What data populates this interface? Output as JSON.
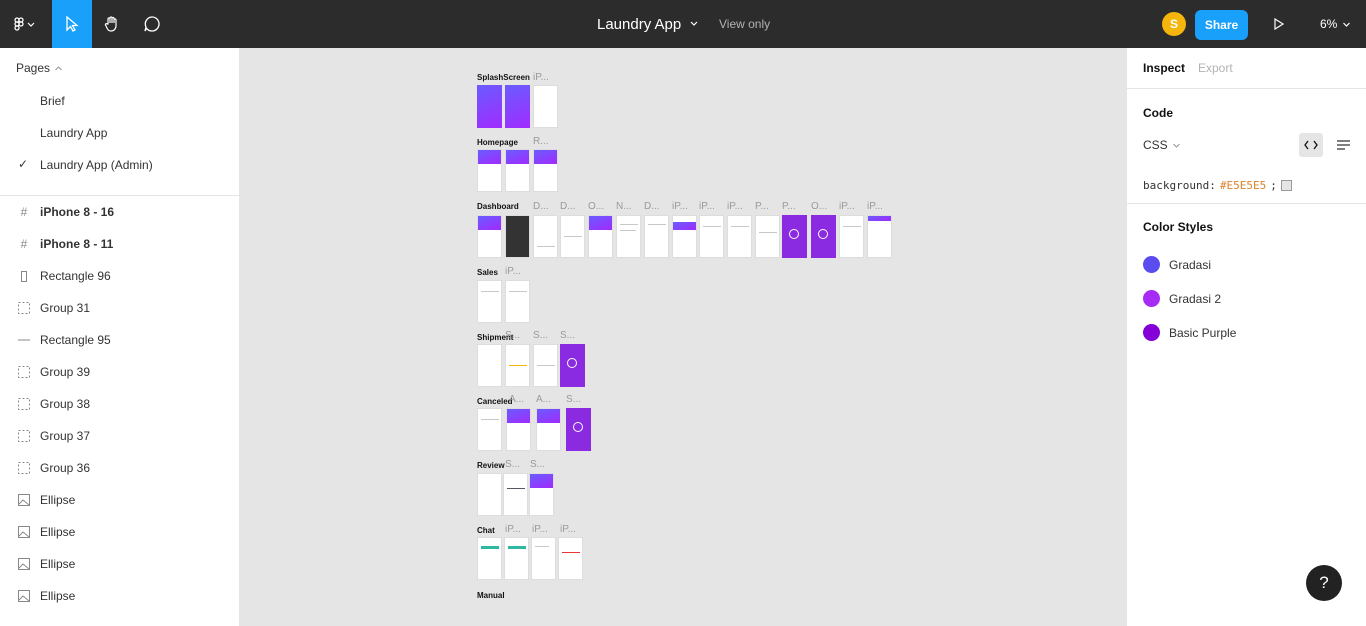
{
  "header": {
    "file_title": "Laundry App",
    "view_mode": "View only",
    "avatar_initial": "S",
    "share_label": "Share",
    "zoom_level": "6%",
    "icons": [
      "figma-menu-icon",
      "move-tool-icon",
      "hand-tool-icon",
      "comment-icon",
      "present-icon"
    ]
  },
  "left_panel": {
    "pages_heading": "Pages",
    "pages": [
      "Brief",
      "Laundry App",
      "Laundry App (Admin)"
    ],
    "current_page": "Laundry App (Admin)",
    "layers": [
      {
        "label": "iPhone 8 - 16",
        "icon": "frame-icon",
        "bold": true
      },
      {
        "label": "iPhone 8 - 11",
        "icon": "frame-icon",
        "bold": true
      },
      {
        "label": "Rectangle 96",
        "icon": "rectangle-icon",
        "bold": false
      },
      {
        "label": "Group 31",
        "icon": "group-icon",
        "bold": false
      },
      {
        "label": "Rectangle 95",
        "icon": "line-icon",
        "bold": false
      },
      {
        "label": "Group 39",
        "icon": "group-icon",
        "bold": false
      },
      {
        "label": "Group 38",
        "icon": "group-icon",
        "bold": false
      },
      {
        "label": "Group 37",
        "icon": "group-icon",
        "bold": false
      },
      {
        "label": "Group 36",
        "icon": "group-icon",
        "bold": false
      },
      {
        "label": "Ellipse",
        "icon": "image-icon",
        "bold": false
      },
      {
        "label": "Ellipse",
        "icon": "image-icon",
        "bold": false
      },
      {
        "label": "Ellipse",
        "icon": "image-icon",
        "bold": false
      },
      {
        "label": "Ellipse",
        "icon": "image-icon",
        "bold": false
      }
    ]
  },
  "canvas": {
    "background": "#E5E5E5",
    "sections": [
      {
        "label": "SplashScreen",
        "frame_labels": [
          "iP..."
        ]
      },
      {
        "label": "Homepage",
        "frame_labels": [
          "R..."
        ]
      },
      {
        "label": "Dashboard",
        "frame_labels": [
          "D...",
          "D...",
          "O...",
          "N...",
          "D...",
          "iP...",
          "iP...",
          "iP...",
          "P...",
          "P...",
          "O...",
          "iP...",
          "iP..."
        ]
      },
      {
        "label": "Sales",
        "frame_labels": [
          "iP..."
        ]
      },
      {
        "label": "Shipment",
        "frame_labels": [
          "S...",
          "S...",
          "S..."
        ]
      },
      {
        "label": "Canceled",
        "frame_labels": [
          "A...",
          "A...",
          "S..."
        ]
      },
      {
        "label": "Review",
        "frame_labels": [
          "S...",
          "S..."
        ]
      },
      {
        "label": "Chat",
        "frame_labels": [
          "iP...",
          "iP...",
          "iP..."
        ]
      },
      {
        "label": "Manual",
        "frame_labels": []
      }
    ]
  },
  "right_panel": {
    "tabs": [
      "Inspect",
      "Export"
    ],
    "code_heading": "Code",
    "language": "CSS",
    "code_property": "background:",
    "code_value": "#E5E5E5",
    "code_end": ";",
    "color_styles_heading": "Color Styles",
    "color_styles": [
      {
        "name": "Gradasi",
        "color": "#5b4cf0"
      },
      {
        "name": "Gradasi 2",
        "color": "#a62bf5"
      },
      {
        "name": "Basic Purple",
        "color": "#8400d6"
      }
    ]
  },
  "help_label": "?"
}
